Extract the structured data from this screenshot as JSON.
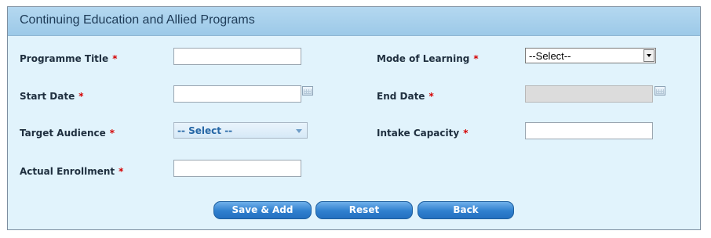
{
  "header": {
    "title": "Continuing Education and Allied Programs"
  },
  "form": {
    "required_marker": "*",
    "programme_title": {
      "label": "Programme Title",
      "value": ""
    },
    "mode_of_learning": {
      "label": "Mode of Learning",
      "selected": "--Select--"
    },
    "start_date": {
      "label": "Start Date",
      "value": ""
    },
    "end_date": {
      "label": "End Date",
      "value": ""
    },
    "target_audience": {
      "label": "Target Audience",
      "selected": "-- Select --"
    },
    "intake_capacity": {
      "label": "Intake Capacity",
      "value": ""
    },
    "actual_enrollment": {
      "label": "Actual Enrollment",
      "value": ""
    }
  },
  "buttons": {
    "save_add": "Save & Add",
    "reset": "Reset",
    "back": "Back"
  },
  "colors": {
    "panel_bg": "#e1f3fc",
    "header_bg": "#a7d0ec",
    "button": "#2f7fce",
    "required": "#d50000"
  },
  "icons": {
    "calendar": "calendar-icon",
    "dropdown": "chevron-down-icon"
  }
}
